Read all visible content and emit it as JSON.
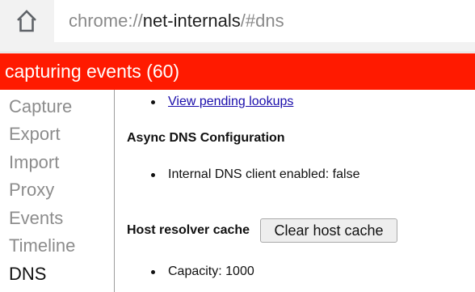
{
  "browser": {
    "url_scheme": "chrome://",
    "url_host": "net-internals",
    "url_path": "/#dns",
    "home_icon": "home-icon"
  },
  "status_bar": {
    "text": "capturing events (60)",
    "color": "#ff1a00"
  },
  "sidebar": {
    "items": [
      {
        "label": "Capture",
        "active": false
      },
      {
        "label": "Export",
        "active": false
      },
      {
        "label": "Import",
        "active": false
      },
      {
        "label": "Proxy",
        "active": false
      },
      {
        "label": "Events",
        "active": false
      },
      {
        "label": "Timeline",
        "active": false
      },
      {
        "label": "DNS",
        "active": true
      }
    ]
  },
  "content": {
    "pending_lookups_link": "View pending lookups",
    "async_heading": "Async DNS Configuration",
    "dns_client_status": "Internal DNS client enabled: false",
    "host_cache_heading": "Host resolver cache",
    "clear_cache_button": "Clear host cache",
    "capacity": "Capacity: 1000"
  }
}
